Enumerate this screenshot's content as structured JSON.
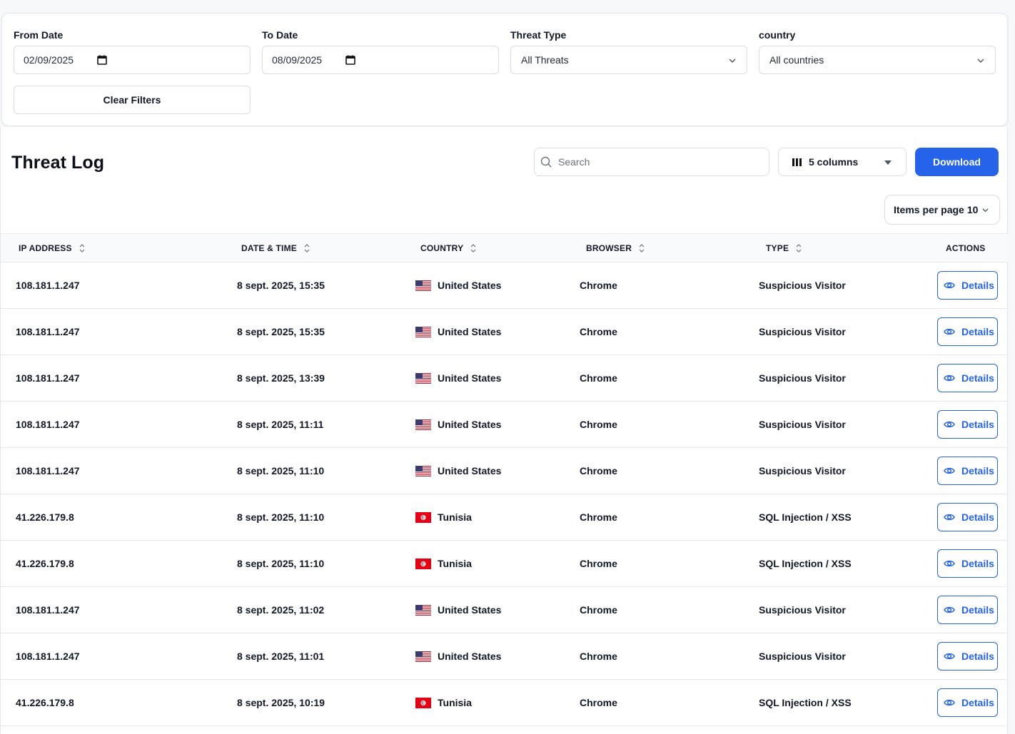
{
  "filters": {
    "from_date": {
      "label": "From Date",
      "value": "02/09/2025"
    },
    "to_date": {
      "label": "To Date",
      "value": "08/09/2025"
    },
    "threat_type": {
      "label": "Threat Type",
      "value": "All Threats"
    },
    "country": {
      "label": "country",
      "value": "All countries"
    },
    "clear_label": "Clear Filters"
  },
  "page": {
    "title": "Threat Log",
    "search_placeholder": "Search",
    "columns_label": "5 columns",
    "download_label": "Download",
    "items_per_page_label": "Items per page",
    "items_per_page_value": "10"
  },
  "colors": {
    "accent": "#2563eb",
    "border": "#d9dde3"
  },
  "table": {
    "columns": [
      "IP ADDRESS",
      "DATE & TIME",
      "COUNTRY",
      "BROWSER",
      "TYPE",
      "ACTIONS"
    ],
    "action_label": "Details",
    "rows": [
      {
        "ip": "108.181.1.247",
        "datetime": "8 sept. 2025, 15:35",
        "country": "United States",
        "flag": "us",
        "browser": "Chrome",
        "type": "Suspicious Visitor"
      },
      {
        "ip": "108.181.1.247",
        "datetime": "8 sept. 2025, 15:35",
        "country": "United States",
        "flag": "us",
        "browser": "Chrome",
        "type": "Suspicious Visitor"
      },
      {
        "ip": "108.181.1.247",
        "datetime": "8 sept. 2025, 13:39",
        "country": "United States",
        "flag": "us",
        "browser": "Chrome",
        "type": "Suspicious Visitor"
      },
      {
        "ip": "108.181.1.247",
        "datetime": "8 sept. 2025, 11:11",
        "country": "United States",
        "flag": "us",
        "browser": "Chrome",
        "type": "Suspicious Visitor"
      },
      {
        "ip": "108.181.1.247",
        "datetime": "8 sept. 2025, 11:10",
        "country": "United States",
        "flag": "us",
        "browser": "Chrome",
        "type": "Suspicious Visitor"
      },
      {
        "ip": "41.226.179.8",
        "datetime": "8 sept. 2025, 11:10",
        "country": "Tunisia",
        "flag": "tn",
        "browser": "Chrome",
        "type": "SQL Injection / XSS"
      },
      {
        "ip": "41.226.179.8",
        "datetime": "8 sept. 2025, 11:10",
        "country": "Tunisia",
        "flag": "tn",
        "browser": "Chrome",
        "type": "SQL Injection / XSS"
      },
      {
        "ip": "108.181.1.247",
        "datetime": "8 sept. 2025, 11:02",
        "country": "United States",
        "flag": "us",
        "browser": "Chrome",
        "type": "Suspicious Visitor"
      },
      {
        "ip": "108.181.1.247",
        "datetime": "8 sept. 2025, 11:01",
        "country": "United States",
        "flag": "us",
        "browser": "Chrome",
        "type": "Suspicious Visitor"
      },
      {
        "ip": "41.226.179.8",
        "datetime": "8 sept. 2025, 10:19",
        "country": "Tunisia",
        "flag": "tn",
        "browser": "Chrome",
        "type": "SQL Injection / XSS"
      }
    ]
  }
}
